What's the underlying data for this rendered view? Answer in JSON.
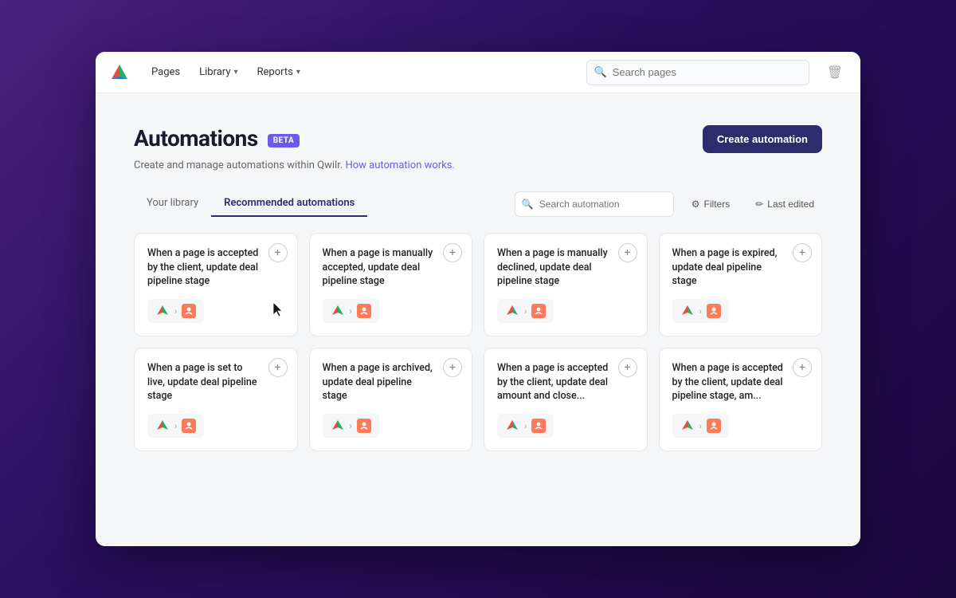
{
  "nav": {
    "links": [
      {
        "label": "Pages",
        "hasDropdown": false
      },
      {
        "label": "Library",
        "hasDropdown": true
      },
      {
        "label": "Reports",
        "hasDropdown": true
      }
    ],
    "search": {
      "placeholder": "Search pages"
    }
  },
  "page": {
    "title": "Automations",
    "beta_label": "BETA",
    "subtitle": "Create and manage automations within Qwilr.",
    "how_link": "How automation works.",
    "create_button": "Create automation"
  },
  "tabs": [
    {
      "label": "Your library",
      "active": false
    },
    {
      "label": "Recommended automations",
      "active": true
    }
  ],
  "filter": {
    "search_placeholder": "Search automation",
    "filters_label": "Filters",
    "last_edited_label": "Last edited"
  },
  "cards": [
    {
      "title": "When a page is accepted by the client, update deal pipeline stage",
      "row": 1
    },
    {
      "title": "When a page is manually accepted, update deal pipeline stage",
      "row": 1
    },
    {
      "title": "When a page is manually declined, update deal pipeline stage",
      "row": 1
    },
    {
      "title": "When a page is expired, update deal pipeline stage",
      "row": 1
    },
    {
      "title": "When a page is set to live, update deal pipeline stage",
      "row": 2
    },
    {
      "title": "When a page is archived, update deal pipeline stage",
      "row": 2
    },
    {
      "title": "When a page is accepted by the client, update deal amount and close...",
      "row": 2
    },
    {
      "title": "When a page is accepted by the client, update deal pipeline stage, am...",
      "row": 2
    }
  ]
}
